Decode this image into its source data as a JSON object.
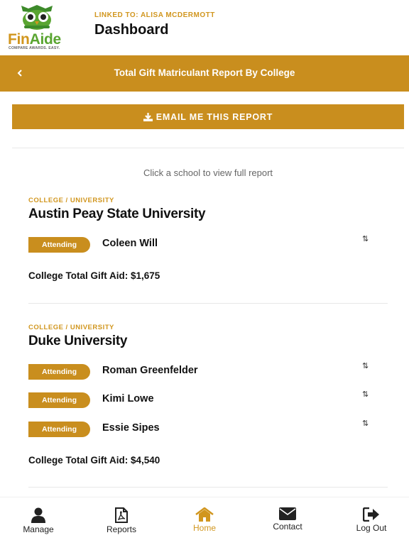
{
  "header": {
    "logo_fin": "Fin",
    "logo_aide": "Aide",
    "logo_tagline": "COMPARE AWARDS. EASY.",
    "linked_to": "LINKED TO: ALISA MCDERMOTT",
    "title": "Dashboard"
  },
  "topbar": {
    "title": "Total Gift Matriculant Report By College"
  },
  "email_button": {
    "label": "EMAIL ME THIS REPORT"
  },
  "hint": "Click a school to view full report",
  "colleges": [
    {
      "label": "COLLEGE / UNIVERSITY",
      "name": "Austin Peay State University",
      "students": [
        {
          "status": "Attending",
          "name": "Coleen Will"
        }
      ],
      "total": "College Total Gift Aid: $1,675"
    },
    {
      "label": "COLLEGE / UNIVERSITY",
      "name": "Duke University",
      "students": [
        {
          "status": "Attending",
          "name": "Roman Greenfelder"
        },
        {
          "status": "Attending",
          "name": "Kimi Lowe"
        },
        {
          "status": "Attending",
          "name": "Essie Sipes"
        }
      ],
      "total": "College Total Gift Aid: $4,540"
    }
  ],
  "nav": [
    {
      "label": "Manage",
      "icon": "user-icon"
    },
    {
      "label": "Reports",
      "icon": "pdf-file-icon"
    },
    {
      "label": "Home",
      "icon": "home-icon",
      "active": true
    },
    {
      "label": "Contact",
      "icon": "envelope-icon"
    },
    {
      "label": "Log Out",
      "icon": "logout-icon"
    }
  ],
  "colors": {
    "accent": "#c98e1e",
    "accent_text": "#d1961e",
    "logo_green": "#5aa531"
  }
}
